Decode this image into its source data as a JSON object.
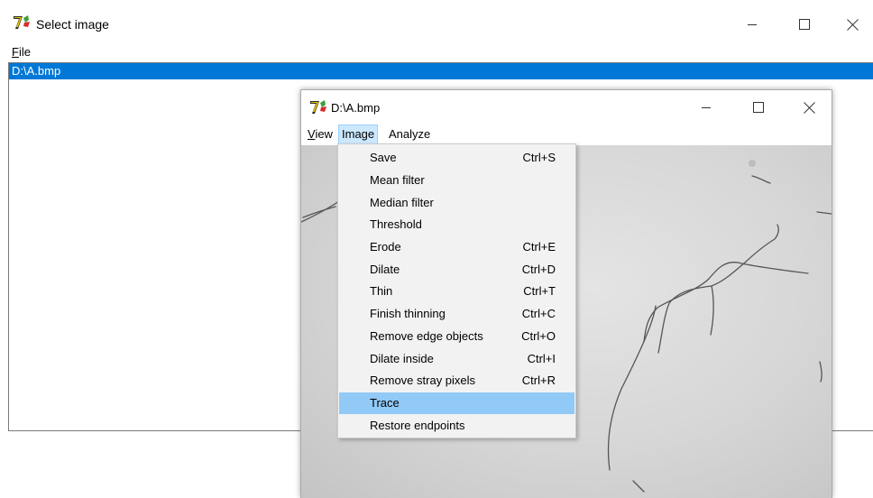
{
  "main_window": {
    "title": "Select image",
    "menu": [
      {
        "label_underlined": "F",
        "label_rest": "ile"
      }
    ],
    "list_items": [
      "D:\\A.bmp"
    ]
  },
  "child_window": {
    "title": "D:\\A.bmp",
    "menu": [
      {
        "label_underlined": "V",
        "label_rest": "iew"
      },
      {
        "label": "Image"
      },
      {
        "label": "Analyze"
      }
    ]
  },
  "image_menu": {
    "items": [
      {
        "label": "Save",
        "shortcut": "Ctrl+S"
      },
      {
        "label": "Mean filter",
        "shortcut": ""
      },
      {
        "label": "Median filter",
        "shortcut": ""
      },
      {
        "label": "Threshold",
        "shortcut": ""
      },
      {
        "label": "Erode",
        "shortcut": "Ctrl+E"
      },
      {
        "label": "Dilate",
        "shortcut": "Ctrl+D"
      },
      {
        "label": "Thin",
        "shortcut": "Ctrl+T"
      },
      {
        "label": "Finish thinning",
        "shortcut": "Ctrl+C"
      },
      {
        "label": "Remove edge objects",
        "shortcut": "Ctrl+O"
      },
      {
        "label": "Dilate inside",
        "shortcut": "Ctrl+I"
      },
      {
        "label": "Remove stray pixels",
        "shortcut": "Ctrl+R"
      },
      {
        "label": "Trace",
        "shortcut": ""
      },
      {
        "label": "Restore endpoints",
        "shortcut": ""
      }
    ],
    "highlighted": "Trace"
  },
  "icons": {
    "app": "app-icon",
    "minimize": "minimize-icon",
    "maximize": "maximize-icon",
    "close": "close-icon"
  },
  "colors": {
    "selection": "#0078d7",
    "menu_highlight": "#91c9f7",
    "active_menu": "#cce8ff"
  }
}
